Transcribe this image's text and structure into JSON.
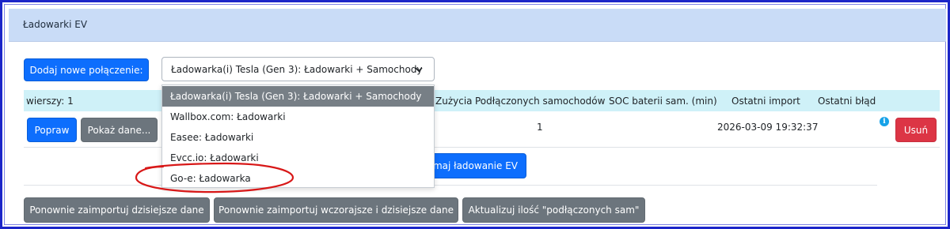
{
  "header": {
    "title": "Ładowarki EV"
  },
  "toolbar": {
    "add_connection_label": "Dodaj nowe połączenie:",
    "selected_option": "Ładowarka(i) Tesla (Gen 3): Ładowarki + Samochody"
  },
  "dropdown": {
    "options": [
      "Ładowarka(i) Tesla (Gen 3): Ładowarki + Samochody",
      "Wallbox.com: Ładowarki",
      "Easee: Ładowarki",
      "Evcc.io: Ładowarki",
      "Go-e: Ładowarka"
    ],
    "selected_index": 0
  },
  "table": {
    "rows_label": "wierszy: 1",
    "columns": [
      "Zużycia",
      "Podłączonych samochodów",
      "SOC baterii sam. (min)",
      "Ostatni import",
      "Ostatni błąd"
    ],
    "rows": [
      {
        "edit_label": "Popraw",
        "show_label": "Pokaż dane...",
        "connected_cars": "1",
        "last_import": "2026-03-09 19:32:37",
        "info_icon": "i",
        "delete_label": "Usuń"
      }
    ]
  },
  "stop_charging_label": "ymaj ładowanie EV",
  "bottom_buttons": {
    "reimport_today": "Ponownie zaimportuj dzisiejsze dane",
    "reimport_yesterday_today": "Ponownie zaimportuj wczorajsze i dzisiejsze dane",
    "update_connected": "Aktualizuj ilość \"podłączonych sam\""
  },
  "colors": {
    "frame_border": "#1b25c8",
    "header_bg": "#c9dcf7",
    "primary": "#0d6efd",
    "secondary": "#6c757d",
    "danger": "#dc3545",
    "table_head_bg": "#cff1f8",
    "selected_option_bg": "#777f86",
    "annotation": "#d81818"
  }
}
